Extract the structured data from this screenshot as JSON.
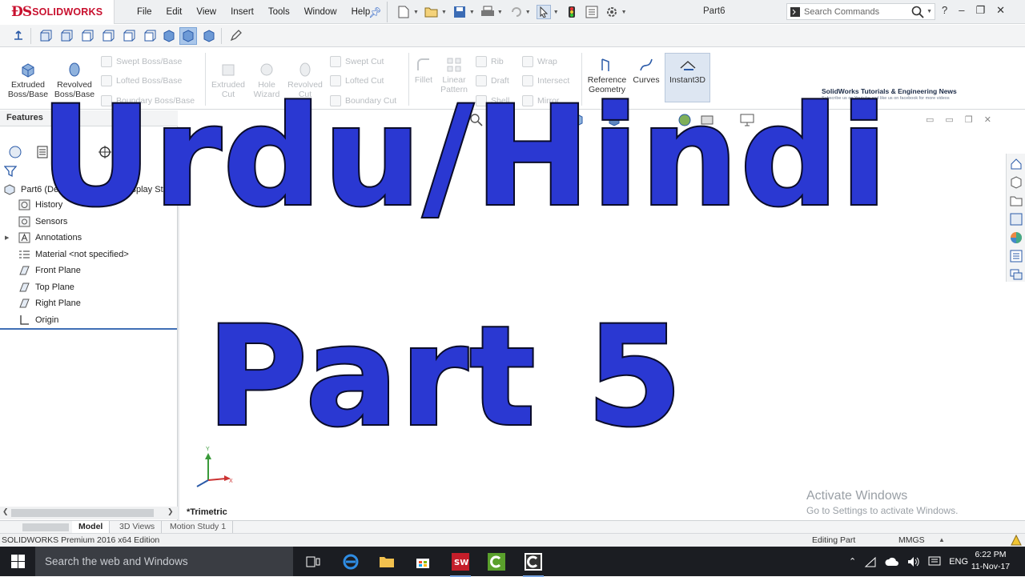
{
  "app": {
    "brand": "SOLIDWORKS",
    "document": "Part6",
    "menu": [
      "File",
      "Edit",
      "View",
      "Insert",
      "Tools",
      "Window",
      "Help"
    ],
    "search_placeholder": "Search Commands",
    "help": "?"
  },
  "ribbon": {
    "extruded_boss": "Extruded Boss/Base",
    "revolved_boss": "Revolved Boss/Base",
    "swept_boss": "Swept Boss/Base",
    "lofted_boss": "Lofted Boss/Base",
    "boundary_boss": "Boundary Boss/Base",
    "extruded_cut": "Extruded Cut",
    "hole_wizard": "Hole Wizard",
    "revolved_cut": "Revolved Cut",
    "swept_cut": "Swept Cut",
    "lofted_cut": "Lofted Cut",
    "boundary_cut": "Boundary Cut",
    "fillet": "Fillet",
    "linear_pattern": "Linear Pattern",
    "rib": "Rib",
    "draft": "Draft",
    "shell": "Shell",
    "wrap": "Wrap",
    "intersect": "Intersect",
    "mirror": "Mirror",
    "reference_geometry": "Reference Geometry",
    "curves": "Curves",
    "instant3d": "Instant3D"
  },
  "banner": {
    "title": "SolidWorks Tutorials & Engineering News",
    "subtitle": "Subscribe us on Youtube and like us on facebook for more videos"
  },
  "panel": {
    "tab_label": "Features",
    "root": "Part6 (Default<<Default>_Display State",
    "tree": [
      "History",
      "Sensors",
      "Annotations",
      "Material <not specified>",
      "Front Plane",
      "Top Plane",
      "Right Plane",
      "Origin"
    ]
  },
  "viewport": {
    "view_name": "*Trimetric",
    "triad_y": "Y",
    "triad_x": "X",
    "overlay_line1": "Urdu/Hindi",
    "overlay_line2": "Part 5",
    "overlay_color": "#2a38d2",
    "activate_title": "Activate Windows",
    "activate_sub": "Go to Settings to activate Windows."
  },
  "bottom_tabs": [
    "Model",
    "3D Views",
    "Motion Study 1"
  ],
  "status": {
    "edition": "SOLIDWORKS Premium 2016 x64 Edition",
    "mode": "Editing Part",
    "units": "MMGS"
  },
  "taskbar": {
    "search_placeholder": "Search the web and Windows",
    "language": "ENG",
    "time": "6:22 PM",
    "date": "11-Nov-17"
  }
}
